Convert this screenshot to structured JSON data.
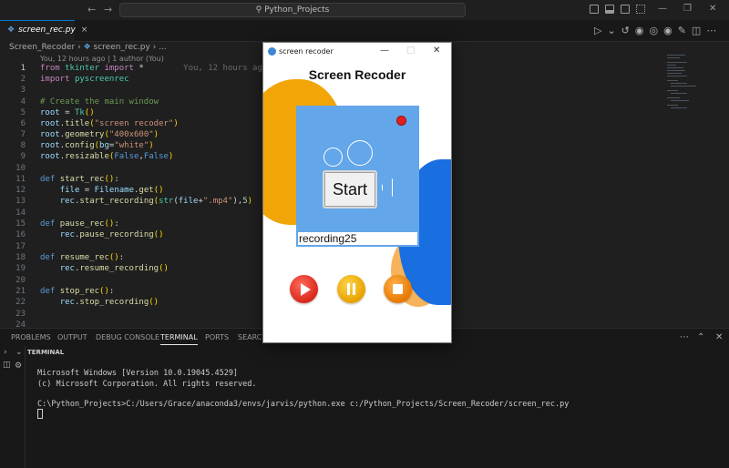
{
  "titlebar": {
    "search_text": "Python_Projects",
    "back_icon": "arrow-left-icon",
    "forward_icon": "arrow-right-icon"
  },
  "tabs": [
    {
      "label": "screen_rec.py",
      "active": true
    }
  ],
  "breadcrumb": {
    "folder": "Screen_Recoder",
    "file": "screen_rec.py",
    "trail": "..."
  },
  "codelens": "You, 12 hours ago | 1 author (You)",
  "inline_blame": "You, 12 hours ago • Sc",
  "editor": {
    "line_numbers": [
      "1",
      "2",
      "3",
      "4",
      "5",
      "6",
      "7",
      "8",
      "9",
      "10",
      "11",
      "12",
      "13",
      "14",
      "15",
      "16",
      "17",
      "18",
      "19",
      "20",
      "21",
      "22",
      "23",
      "24"
    ],
    "current_line": "1"
  },
  "panel": {
    "tabs": [
      "PROBLEMS",
      "OUTPUT",
      "DEBUG CONSOLE",
      "TERMINAL",
      "PORTS",
      "SEARCH"
    ],
    "active_tab": "TERMINAL",
    "section_label": "TERMINAL",
    "terminal_lines": [
      "Microsoft Windows [Version 10.0.19045.4529]",
      "(c) Microsoft Corporation. All rights reserved.",
      "",
      "C:\\Python_Projects>C:/Users/Grace/anaconda3/envs/jarvis/python.exe c:/Python_Projects/Screen_Recoder/screen_rec.py"
    ]
  },
  "app_window": {
    "title": "screen recoder",
    "heading": "Screen Recoder",
    "start_label": "Start",
    "filename_value": "recording25"
  },
  "colors": {
    "accent": "#0078d4",
    "blob_yellow": "#f2a507",
    "blob_blue": "#1a6fe0",
    "camera_panel": "#63a6e9",
    "play": "#d8281c",
    "pause": "#e8a100",
    "stop": "#e67800"
  }
}
